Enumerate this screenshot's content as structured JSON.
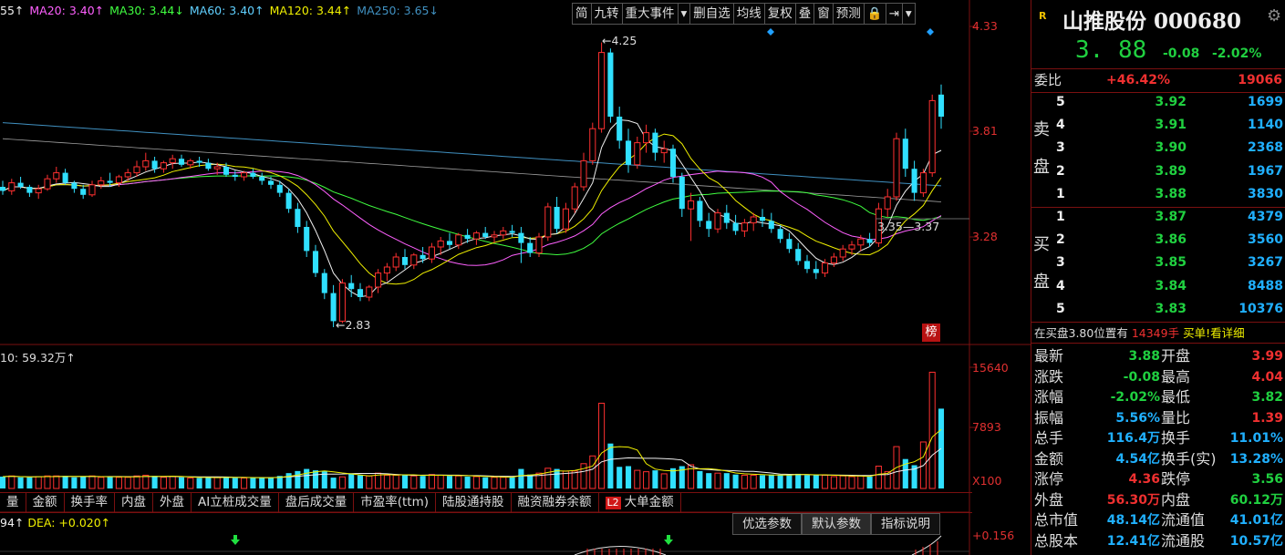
{
  "ma_bar": [
    {
      "text": "55↑",
      "color": "#f0f0f0"
    },
    {
      "text": "MA20: 3.40↑",
      "color": "#ff60ff"
    },
    {
      "text": "MA30: 3.44↓",
      "color": "#40ff40"
    },
    {
      "text": "MA60: 3.40↑",
      "color": "#60d0ff"
    },
    {
      "text": "MA120: 3.44↑",
      "color": "#f0f000"
    },
    {
      "text": "MA250: 3.65↓",
      "color": "#4090c0"
    }
  ],
  "toolbar": [
    "简",
    "九转",
    "重大事件",
    "▾",
    "删自选",
    "均线",
    "复权",
    "叠",
    "窗",
    "预测",
    "🔒",
    "⇥",
    "▾"
  ],
  "price_axis": [
    "4.33",
    "3.81",
    "3.28"
  ],
  "annotations": {
    "high": "4.25",
    "low": "2.83",
    "right": "3.35—3.37"
  },
  "bang_label": "榜",
  "volume_label": "10: 59.32万↑",
  "volume_axis": [
    "15640",
    "7893",
    "X100"
  ],
  "tabs": [
    "量",
    "金额",
    "换手率",
    "内盘",
    "外盘",
    "AI立桩成交量",
    "盘后成交量",
    "市盈率(ttm)",
    "陆股通持股",
    "融资融券余额",
    "大单金额"
  ],
  "tab_badge": "L2",
  "macd": {
    "prefix": "94↑",
    "dea": "DEA: +0.020↑",
    "axis": "+0.156"
  },
  "param_buttons": [
    "优选参数",
    "默认参数",
    "指标说明"
  ],
  "panel": {
    "badge": "R",
    "name": "山推股份 000680",
    "price": "3. 88",
    "change": "-0.08",
    "change_pct": "-2.02%",
    "weibi_label": "委比",
    "weibi_pct": "+46.42%",
    "weibi_val": "19066",
    "sell_label": [
      "卖",
      "盘"
    ],
    "buy_label": [
      "买",
      "盘"
    ],
    "sell": [
      {
        "lvl": "5",
        "price": "3.92",
        "vol": "1699"
      },
      {
        "lvl": "4",
        "price": "3.91",
        "vol": "1140"
      },
      {
        "lvl": "3",
        "price": "3.90",
        "vol": "2368"
      },
      {
        "lvl": "2",
        "price": "3.89",
        "vol": "1967"
      },
      {
        "lvl": "1",
        "price": "3.88",
        "vol": "3830"
      }
    ],
    "buy": [
      {
        "lvl": "1",
        "price": "3.87",
        "vol": "4379"
      },
      {
        "lvl": "2",
        "price": "3.86",
        "vol": "3560"
      },
      {
        "lvl": "3",
        "price": "3.85",
        "vol": "3267"
      },
      {
        "lvl": "4",
        "price": "3.84",
        "vol": "8488"
      },
      {
        "lvl": "5",
        "price": "3.83",
        "vol": "10376"
      }
    ],
    "notice": {
      "a": "在买盘3.80位置有",
      "b": "14349手",
      "c": " 买单!看详细"
    },
    "stats": [
      {
        "k1": "最新",
        "v1": "3.88",
        "c1": "#20d040",
        "k2": "开盘",
        "v2": "3.99",
        "c2": "#f03030"
      },
      {
        "k1": "涨跌",
        "v1": "-0.08",
        "c1": "#20d040",
        "k2": "最高",
        "v2": "4.04",
        "c2": "#f03030"
      },
      {
        "k1": "涨幅",
        "v1": "-2.02%",
        "c1": "#20d040",
        "k2": "最低",
        "v2": "3.82",
        "c2": "#20d040"
      },
      {
        "k1": "振幅",
        "v1": "5.56%",
        "c1": "#20b0ff",
        "k2": "量比",
        "v2": "1.39",
        "c2": "#f03030"
      },
      {
        "k1": "总手",
        "v1": "116.4万",
        "c1": "#20b0ff",
        "k2": "换手",
        "v2": "11.01%",
        "c2": "#20b0ff"
      },
      {
        "k1": "金额",
        "v1": "4.54亿",
        "c1": "#20b0ff",
        "k2": "换手(实)",
        "v2": "13.28%",
        "c2": "#20b0ff"
      },
      {
        "k1": "涨停",
        "v1": "4.36",
        "c1": "#f03030",
        "k2": "跌停",
        "v2": "3.56",
        "c2": "#20d040"
      },
      {
        "k1": "外盘",
        "v1": "56.30万",
        "c1": "#f03030",
        "k2": "内盘",
        "v2": "60.12万",
        "c2": "#20d040"
      },
      {
        "k1": "总市值",
        "v1": "48.14亿",
        "c1": "#20b0ff",
        "k2": "流通值",
        "v2": "41.01亿",
        "c2": "#20b0ff"
      },
      {
        "k1": "总股本",
        "v1": "12.41亿",
        "c1": "#20b0ff",
        "k2": "流通股",
        "v2": "10.57亿",
        "c2": "#20b0ff"
      }
    ]
  },
  "chart_data": {
    "type": "candlestick",
    "candles": [
      [
        3.53,
        3.56,
        3.49,
        3.51
      ],
      [
        3.51,
        3.57,
        3.49,
        3.55
      ],
      [
        3.55,
        3.58,
        3.52,
        3.53
      ],
      [
        3.53,
        3.54,
        3.48,
        3.5
      ],
      [
        3.5,
        3.54,
        3.47,
        3.52
      ],
      [
        3.52,
        3.59,
        3.51,
        3.57
      ],
      [
        3.57,
        3.63,
        3.55,
        3.6
      ],
      [
        3.6,
        3.62,
        3.54,
        3.55
      ],
      [
        3.55,
        3.56,
        3.5,
        3.52
      ],
      [
        3.52,
        3.54,
        3.47,
        3.49
      ],
      [
        3.49,
        3.56,
        3.48,
        3.54
      ],
      [
        3.54,
        3.58,
        3.52,
        3.56
      ],
      [
        3.56,
        3.6,
        3.53,
        3.55
      ],
      [
        3.55,
        3.59,
        3.53,
        3.58
      ],
      [
        3.58,
        3.62,
        3.56,
        3.6
      ],
      [
        3.6,
        3.66,
        3.58,
        3.63
      ],
      [
        3.63,
        3.7,
        3.61,
        3.66
      ],
      [
        3.66,
        3.68,
        3.6,
        3.62
      ],
      [
        3.62,
        3.66,
        3.6,
        3.65
      ],
      [
        3.65,
        3.69,
        3.62,
        3.67
      ],
      [
        3.67,
        3.69,
        3.63,
        3.64
      ],
      [
        3.64,
        3.67,
        3.62,
        3.66
      ],
      [
        3.66,
        3.68,
        3.63,
        3.65
      ],
      [
        3.65,
        3.67,
        3.61,
        3.62
      ],
      [
        3.62,
        3.65,
        3.59,
        3.63
      ],
      [
        3.63,
        3.65,
        3.58,
        3.59
      ],
      [
        3.59,
        3.61,
        3.56,
        3.58
      ],
      [
        3.58,
        3.61,
        3.56,
        3.6
      ],
      [
        3.6,
        3.62,
        3.57,
        3.58
      ],
      [
        3.58,
        3.6,
        3.54,
        3.56
      ],
      [
        3.56,
        3.58,
        3.52,
        3.54
      ],
      [
        3.54,
        3.56,
        3.48,
        3.5
      ],
      [
        3.5,
        3.52,
        3.4,
        3.42
      ],
      [
        3.42,
        3.45,
        3.3,
        3.33
      ],
      [
        3.33,
        3.36,
        3.18,
        3.21
      ],
      [
        3.21,
        3.24,
        3.08,
        3.1
      ],
      [
        3.1,
        3.12,
        2.97,
        3.0
      ],
      [
        3.0,
        3.04,
        2.83,
        2.86
      ],
      [
        2.86,
        3.07,
        2.85,
        3.05
      ],
      [
        3.05,
        3.09,
        2.98,
        3.02
      ],
      [
        3.02,
        3.05,
        2.96,
        2.98
      ],
      [
        2.98,
        3.04,
        2.96,
        3.03
      ],
      [
        3.03,
        3.12,
        3.0,
        3.1
      ],
      [
        3.1,
        3.15,
        3.06,
        3.13
      ],
      [
        3.13,
        3.2,
        3.11,
        3.18
      ],
      [
        3.18,
        3.22,
        3.12,
        3.14
      ],
      [
        3.14,
        3.2,
        3.12,
        3.19
      ],
      [
        3.19,
        3.23,
        3.15,
        3.17
      ],
      [
        3.17,
        3.25,
        3.15,
        3.23
      ],
      [
        3.23,
        3.28,
        3.19,
        3.26
      ],
      [
        3.26,
        3.3,
        3.22,
        3.24
      ],
      [
        3.24,
        3.3,
        3.22,
        3.29
      ],
      [
        3.29,
        3.32,
        3.25,
        3.27
      ],
      [
        3.27,
        3.31,
        3.24,
        3.3
      ],
      [
        3.3,
        3.33,
        3.27,
        3.28
      ],
      [
        3.28,
        3.31,
        3.25,
        3.29
      ],
      [
        3.29,
        3.33,
        3.27,
        3.31
      ],
      [
        3.31,
        3.34,
        3.28,
        3.3
      ],
      [
        3.3,
        3.33,
        3.15,
        3.25
      ],
      [
        3.25,
        3.28,
        3.18,
        3.2
      ],
      [
        3.2,
        3.3,
        3.18,
        3.28
      ],
      [
        3.28,
        3.45,
        3.26,
        3.43
      ],
      [
        3.43,
        3.48,
        3.3,
        3.32
      ],
      [
        3.32,
        3.45,
        3.3,
        3.42
      ],
      [
        3.42,
        3.55,
        3.4,
        3.53
      ],
      [
        3.53,
        3.7,
        3.51,
        3.66
      ],
      [
        3.66,
        3.85,
        3.64,
        3.82
      ],
      [
        3.82,
        4.25,
        3.8,
        4.2
      ],
      [
        4.2,
        4.22,
        3.85,
        3.88
      ],
      [
        3.88,
        3.93,
        3.72,
        3.76
      ],
      [
        3.76,
        3.82,
        3.6,
        3.64
      ],
      [
        3.64,
        3.78,
        3.62,
        3.75
      ],
      [
        3.75,
        3.84,
        3.7,
        3.8
      ],
      [
        3.8,
        3.82,
        3.66,
        3.7
      ],
      [
        3.7,
        3.76,
        3.65,
        3.72
      ],
      [
        3.72,
        3.74,
        3.55,
        3.58
      ],
      [
        3.58,
        3.6,
        3.38,
        3.42
      ],
      [
        3.42,
        3.5,
        3.26,
        3.46
      ],
      [
        3.46,
        3.48,
        3.33,
        3.36
      ],
      [
        3.36,
        3.4,
        3.28,
        3.32
      ],
      [
        3.32,
        3.42,
        3.3,
        3.4
      ],
      [
        3.4,
        3.44,
        3.32,
        3.35
      ],
      [
        3.35,
        3.39,
        3.29,
        3.31
      ],
      [
        3.31,
        3.37,
        3.28,
        3.35
      ],
      [
        3.35,
        3.4,
        3.31,
        3.38
      ],
      [
        3.38,
        3.42,
        3.33,
        3.36
      ],
      [
        3.36,
        3.4,
        3.3,
        3.32
      ],
      [
        3.32,
        3.34,
        3.25,
        3.27
      ],
      [
        3.27,
        3.3,
        3.2,
        3.22
      ],
      [
        3.22,
        3.25,
        3.14,
        3.16
      ],
      [
        3.16,
        3.19,
        3.1,
        3.12
      ],
      [
        3.12,
        3.16,
        3.07,
        3.1
      ],
      [
        3.1,
        3.17,
        3.08,
        3.15
      ],
      [
        3.15,
        3.2,
        3.13,
        3.18
      ],
      [
        3.18,
        3.24,
        3.16,
        3.22
      ],
      [
        3.22,
        3.26,
        3.19,
        3.24
      ],
      [
        3.24,
        3.29,
        3.21,
        3.27
      ],
      [
        3.27,
        3.3,
        3.23,
        3.25
      ],
      [
        3.25,
        3.45,
        3.23,
        3.42
      ],
      [
        3.42,
        3.52,
        3.38,
        3.48
      ],
      [
        3.48,
        3.8,
        3.46,
        3.77
      ],
      [
        3.77,
        3.82,
        3.58,
        3.62
      ],
      [
        3.62,
        3.66,
        3.46,
        3.5
      ],
      [
        3.5,
        3.62,
        3.48,
        3.6
      ],
      [
        3.6,
        3.99,
        3.58,
        3.96
      ],
      [
        3.99,
        4.04,
        3.82,
        3.88
      ]
    ],
    "vol_ma": [
      23,
      23,
      23,
      22,
      22,
      21,
      21,
      21,
      22,
      22
    ]
  }
}
